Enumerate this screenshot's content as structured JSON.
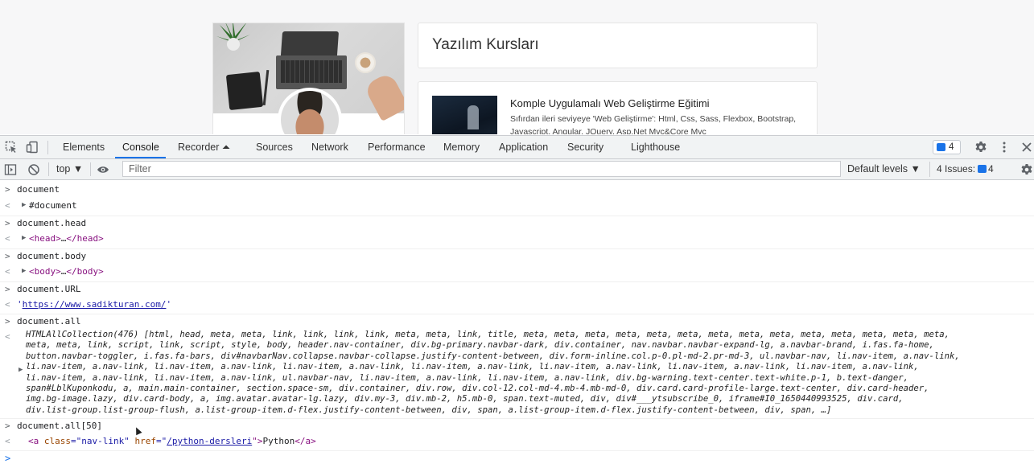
{
  "page": {
    "section_title": "Yazılım Kursları",
    "course": {
      "title": "Komple Uygulamalı Web Geliştirme Eğitimi",
      "description": "Sıfırdan ileri seviyeye 'Web Geliştirme': Html, Css, Sass, Flexbox, Bootstrap, Javascript, Angular, JQuery, Asp.Net Mvc&Core Mvc"
    }
  },
  "devtools": {
    "tabs": [
      {
        "label": "Elements"
      },
      {
        "label": "Console"
      },
      {
        "label": "Recorder ⏶"
      },
      {
        "label": "Sources"
      },
      {
        "label": "Network"
      },
      {
        "label": "Performance"
      },
      {
        "label": "Memory"
      },
      {
        "label": "Application"
      },
      {
        "label": "Security"
      },
      {
        "label": "Lighthouse"
      }
    ],
    "active_tab": "Console",
    "issue_badge_count": "4",
    "toolbar": {
      "context": "top ▼",
      "filter_placeholder": "Filter",
      "levels": "Default levels ▼",
      "issues_label": "4 Issues:",
      "issues_count": "4"
    },
    "console": {
      "entries": [
        {
          "input": "document",
          "output": "#document"
        },
        {
          "input": "document.head",
          "output_open": "<head>",
          "output_mid": "…",
          "output_close": "</head>"
        },
        {
          "input": "document.body",
          "output_open": "<body>",
          "output_mid": "…",
          "output_close": "</body>"
        },
        {
          "input": "document.URL",
          "output_quote_open": "'",
          "output_url": "https://www.sadikturan.com/",
          "output_quote_close": "'"
        },
        {
          "input": "document.all",
          "output_lines": [
            "HTMLAllCollection(476) [html, head, meta, meta, link, link, link, link, meta, meta, link, title, meta, meta, meta, meta, meta, meta, meta, meta, meta, meta, meta, meta, meta, meta,",
            "meta, meta, link, script, link, script, style, body, header.nav-container, div.bg-primary.navbar-dark, div.container, nav.navbar.navbar-expand-lg, a.navbar-brand, i.fas.fa-home,",
            "button.navbar-toggler, i.fas.fa-bars, div#navbarNav.collapse.navbar-collapse.justify-content-between, div.form-inline.col.p-0.pl-md-2.pr-md-3, ul.navbar-nav, li.nav-item, a.nav-link,",
            "li.nav-item, a.nav-link, li.nav-item, a.nav-link, li.nav-item, a.nav-link, li.nav-item, a.nav-link, li.nav-item, a.nav-link, li.nav-item, a.nav-link, li.nav-item, a.nav-link,",
            "li.nav-item, a.nav-link, li.nav-item, a.nav-link, ul.navbar-nav, li.nav-item, a.nav-link, li.nav-item, a.nav-link, div.bg-warning.text-center.text-white.p-1, b.text-danger,",
            "span#LblKuponkodu, a, main.main-container, section.space-sm, div.container, div.row, div.col-12.col-md-4.mb-4.mb-md-0, div.card.card-profile-large.text-center, div.card-header,",
            "img.bg-image.lazy, div.card-body, a, img.avatar.avatar-lg.lazy, div.my-3, div.mb-2, h5.mb-0, span.text-muted, div, div#___ytsubscribe_0, iframe#I0_1650440993525, div.card,",
            "div.list-group.list-group-flush, a.list-group-item.d-flex.justify-content-between, div, span, a.list-group-item.d-flex.justify-content-between, div, span, …]"
          ]
        },
        {
          "input": "document.all[50]",
          "output_tag_open": "<a ",
          "output_attr1": "class",
          "output_val1": "=\"nav-link\" ",
          "output_attr2": "href",
          "output_eq": "=\"",
          "output_href": "/python-dersleri",
          "output_tag_mid": "\">",
          "output_text": "Python",
          "output_tag_close": "</a>"
        }
      ]
    },
    "symbols": {
      "prompt": ">",
      "return": "<",
      "expand": "▶",
      "input_caret": ">"
    }
  }
}
